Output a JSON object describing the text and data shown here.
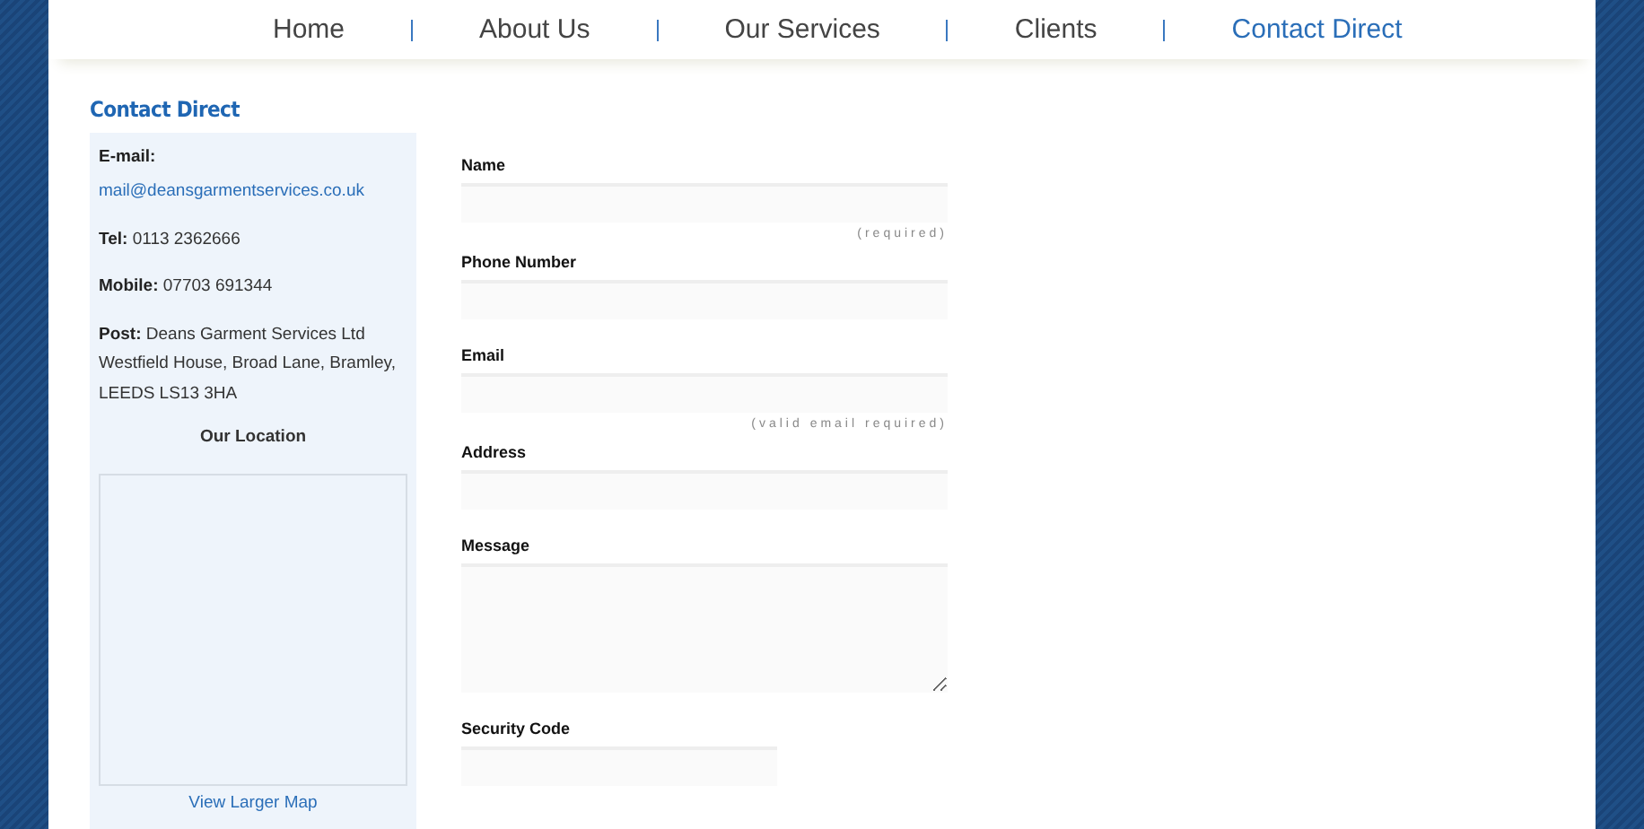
{
  "nav": [
    {
      "label": "Home",
      "selected": false
    },
    {
      "label": "About Us",
      "selected": false
    },
    {
      "label": "Our Services",
      "selected": false
    },
    {
      "label": "Clients",
      "selected": false
    },
    {
      "label": "Contact Direct",
      "selected": true
    }
  ],
  "heading": "Contact Direct",
  "sidebar": {
    "email_label": "E-mail:",
    "email": "mail@deansgarmentservices.co.uk",
    "details": [
      {
        "label": "Tel:",
        "value": "0113 2362666"
      },
      {
        "label": "Mobile:",
        "value": "07703 691344"
      },
      {
        "label": "Post:",
        "value": "Deans Garment Services Ltd Westfield House, Broad Lane, Bramley, LEEDS LS13 3HA"
      }
    ],
    "location_title": "Our Location",
    "map_link": "View Larger Map"
  },
  "form": {
    "fields": [
      {
        "label": "Name",
        "kind": "text",
        "hint": "(required)"
      },
      {
        "label": "Phone Number",
        "kind": "text"
      },
      {
        "label": "Email",
        "kind": "text",
        "hint": "(valid email required)"
      },
      {
        "label": "Address",
        "kind": "text"
      },
      {
        "label": "Message",
        "kind": "textarea"
      },
      {
        "label": "Security Code",
        "kind": "short"
      }
    ]
  }
}
